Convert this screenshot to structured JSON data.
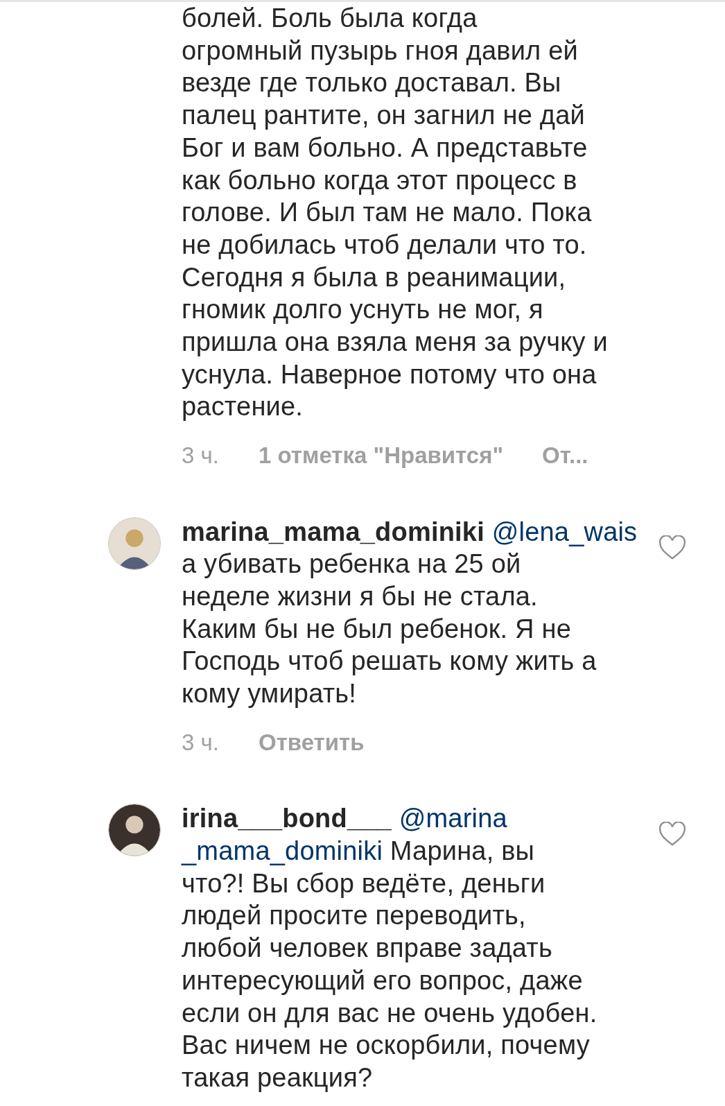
{
  "comments": [
    {
      "text": "болей. Боль была когда\nогромный пузырь гноя давил ей\nвезде где только доставал. Вы\nпалец рантите, он загнил не дай\nБог и вам больно. А представьте\nкак больно когда этот процесс в\nголове. И был там не мало. Пока\nне добилась чтоб делали что то.\nСегодня я была в реанимации,\nгномик долго уснуть не мог, я\nпришла она взяла меня за ручку и\nуснула. Наверное потому что она\nрастение.",
      "time": "3 ч.",
      "likes": "1 отметка \"Нравится\"",
      "reply": "От..."
    },
    {
      "username": "marina_mama_dominiki",
      "mention": "@lena_wais",
      "text": "\nа убивать ребенка на 25 ой\nнеделе жизни я бы не стала.\nКаким бы не был ребенок. Я не\nГосподь чтоб решать кому жить а\nкому умирать!",
      "time": "3 ч.",
      "reply": "Ответить",
      "liked": false
    },
    {
      "username": "irina___bond___",
      "mention": "@marina\n_mama_dominiki",
      "text": " Марина, вы\nчто?! Вы сбор ведёте, деньги\nлюдей просите переводить,\nлюбой  человек вправе задать\nинтересующий его вопрос, даже\nесли он для вас не очень удобен.\nВас ничем не оскорбили, почему\nтакая реакция?",
      "liked": false
    }
  ]
}
